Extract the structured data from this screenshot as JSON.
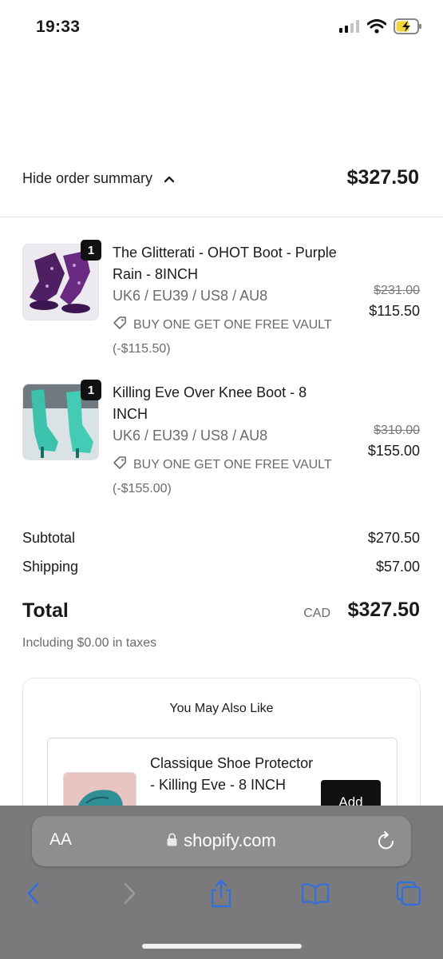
{
  "status": {
    "time": "19:33"
  },
  "summary": {
    "toggle_label": "Hide order summary",
    "total": "$327.50"
  },
  "items": [
    {
      "qty": "1",
      "title": "The Glitterati - OHOT Boot - Purple Rain - 8INCH",
      "variant": "UK6 / EU39 / US8 / AU8",
      "discount": "BUY ONE GET ONE FREE VAULT",
      "discount_amount": "(-$115.50)",
      "price_old": "$231.00",
      "price_new": "$115.50",
      "thumb_color": "#5b2a6e"
    },
    {
      "qty": "1",
      "title": "Killing Eve Over Knee Boot - 8 INCH",
      "variant": "UK6 / EU39 / US8 / AU8",
      "discount": "BUY ONE GET ONE FREE VAULT",
      "discount_amount": "(-$155.00)",
      "price_old": "$310.00",
      "price_new": "$155.00",
      "thumb_color": "#3fb8a8"
    }
  ],
  "totals": {
    "subtotal_label": "Subtotal",
    "subtotal": "$270.50",
    "shipping_label": "Shipping",
    "shipping": "$57.00",
    "total_label": "Total",
    "currency": "CAD",
    "total": "$327.50",
    "taxes_note": "Including $0.00 in taxes"
  },
  "upsell": {
    "heading": "You May Also Like",
    "product_title": "Classique Shoe Protector - Killing Eve - 8 INCH",
    "add_label": "Add"
  },
  "browser": {
    "aa_label": "AA",
    "url": "shopify.com"
  },
  "colors": {
    "accent_ios": "#2f6fe0",
    "badge": "#111111"
  }
}
